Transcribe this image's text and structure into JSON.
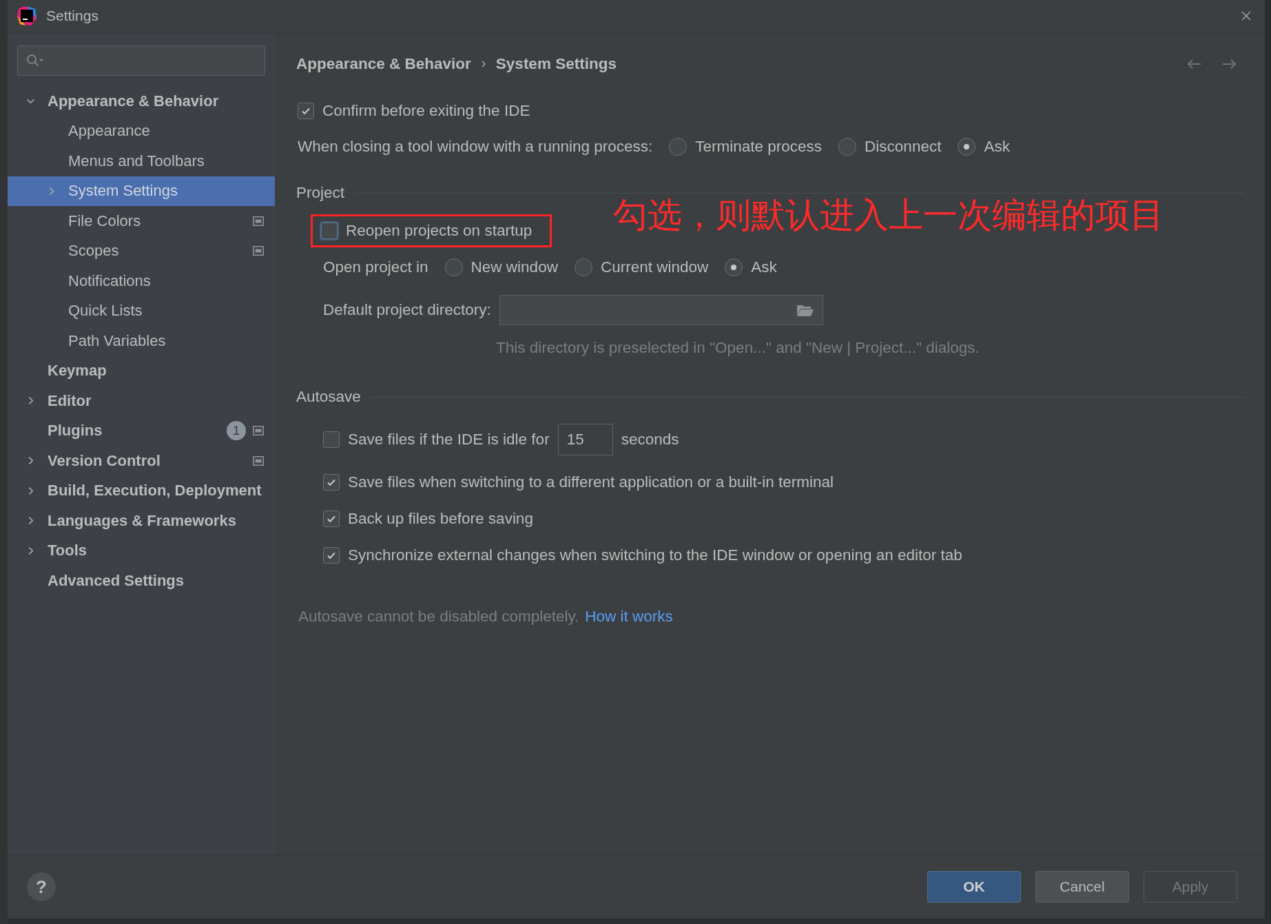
{
  "window": {
    "title": "Settings"
  },
  "sidebar": {
    "items": [
      {
        "label": "Appearance & Behavior",
        "expanded": true,
        "selected": false,
        "scoped": false,
        "children": [
          {
            "label": "Appearance",
            "selected": false,
            "scoped": false
          },
          {
            "label": "Menus and Toolbars",
            "selected": false,
            "scoped": false
          },
          {
            "label": "System Settings",
            "expanded": false,
            "selected": true,
            "scoped": false
          },
          {
            "label": "File Colors",
            "selected": false,
            "scoped": true
          },
          {
            "label": "Scopes",
            "selected": false,
            "scoped": true
          },
          {
            "label": "Notifications",
            "selected": false,
            "scoped": false
          },
          {
            "label": "Quick Lists",
            "selected": false,
            "scoped": false
          },
          {
            "label": "Path Variables",
            "selected": false,
            "scoped": false
          }
        ]
      },
      {
        "label": "Keymap",
        "selected": false,
        "scoped": false
      },
      {
        "label": "Editor",
        "expanded": false,
        "selected": false,
        "scoped": false
      },
      {
        "label": "Plugins",
        "selected": false,
        "scoped": true,
        "badge": "1"
      },
      {
        "label": "Version Control",
        "expanded": false,
        "selected": false,
        "scoped": true
      },
      {
        "label": "Build, Execution, Deployment",
        "expanded": false,
        "selected": false,
        "scoped": false
      },
      {
        "label": "Languages & Frameworks",
        "expanded": false,
        "selected": false,
        "scoped": false
      },
      {
        "label": "Tools",
        "expanded": false,
        "selected": false,
        "scoped": false
      },
      {
        "label": "Advanced Settings",
        "selected": false,
        "scoped": false
      }
    ]
  },
  "breadcrumb": [
    "Appearance & Behavior",
    "System Settings"
  ],
  "confirm_exit": {
    "label": "Confirm before exiting the IDE",
    "checked": true
  },
  "closing_tool_window": {
    "label": "When closing a tool window with a running process:",
    "options": [
      {
        "label": "Terminate process",
        "selected": false
      },
      {
        "label": "Disconnect",
        "selected": false
      },
      {
        "label": "Ask",
        "selected": true
      }
    ]
  },
  "project": {
    "heading": "Project",
    "reopen": {
      "label": "Reopen projects on startup",
      "checked": false,
      "highlighted": true
    },
    "annotation": "勾选，则默认进入上一次编辑的项目",
    "open_in": {
      "label": "Open project in",
      "options": [
        {
          "label": "New window",
          "selected": false
        },
        {
          "label": "Current window",
          "selected": false
        },
        {
          "label": "Ask",
          "selected": true
        }
      ]
    },
    "directory": {
      "label": "Default project directory:",
      "hint": "This directory is preselected in \"Open...\" and \"New | Project...\" dialogs."
    }
  },
  "autosave": {
    "heading": "Autosave",
    "idle": {
      "label": "Save files if the IDE is idle for",
      "checked": false,
      "value": "15",
      "unit": "seconds"
    },
    "options": [
      {
        "label": "Save files when switching to a different application or a built-in terminal",
        "checked": true
      },
      {
        "label": "Back up files before saving",
        "checked": true
      },
      {
        "label": "Synchronize external changes when switching to the IDE window or opening an editor tab",
        "checked": true
      }
    ],
    "note": "Autosave cannot be disabled completely.",
    "link": "How it works"
  },
  "help": {
    "label": "?"
  },
  "buttons": [
    {
      "label": "OK",
      "kind": "default"
    },
    {
      "label": "Cancel",
      "kind": "normal"
    },
    {
      "label": "Apply",
      "kind": "disabled"
    }
  ]
}
